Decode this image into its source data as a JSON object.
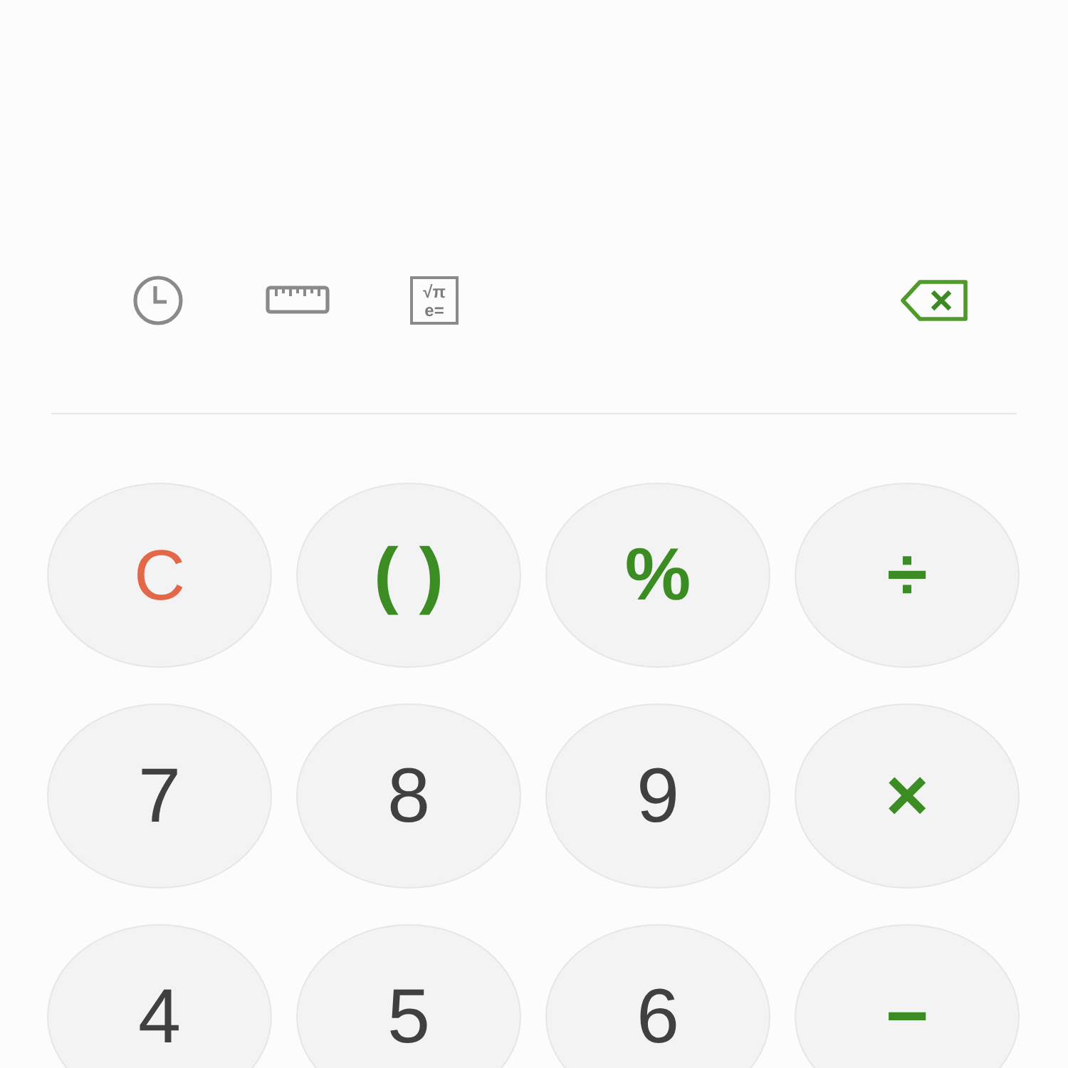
{
  "toolbar": {
    "tools": [
      {
        "kind": "history"
      },
      {
        "kind": "converter"
      },
      {
        "kind": "scientific",
        "top": "√π",
        "bottom": "e="
      }
    ],
    "backspace": {
      "kind": "backspace"
    }
  },
  "keys": [
    {
      "label": "C",
      "kind": "clear"
    },
    {
      "label": "( )",
      "kind": "operator"
    },
    {
      "label": "%",
      "kind": "operator"
    },
    {
      "label": "÷",
      "kind": "operator"
    },
    {
      "label": "7",
      "kind": "digit"
    },
    {
      "label": "8",
      "kind": "digit"
    },
    {
      "label": "9",
      "kind": "digit"
    },
    {
      "label": "×",
      "kind": "operator"
    },
    {
      "label": "4",
      "kind": "digit"
    },
    {
      "label": "5",
      "kind": "digit"
    },
    {
      "label": "6",
      "kind": "digit"
    },
    {
      "label": "−",
      "kind": "operator"
    }
  ]
}
